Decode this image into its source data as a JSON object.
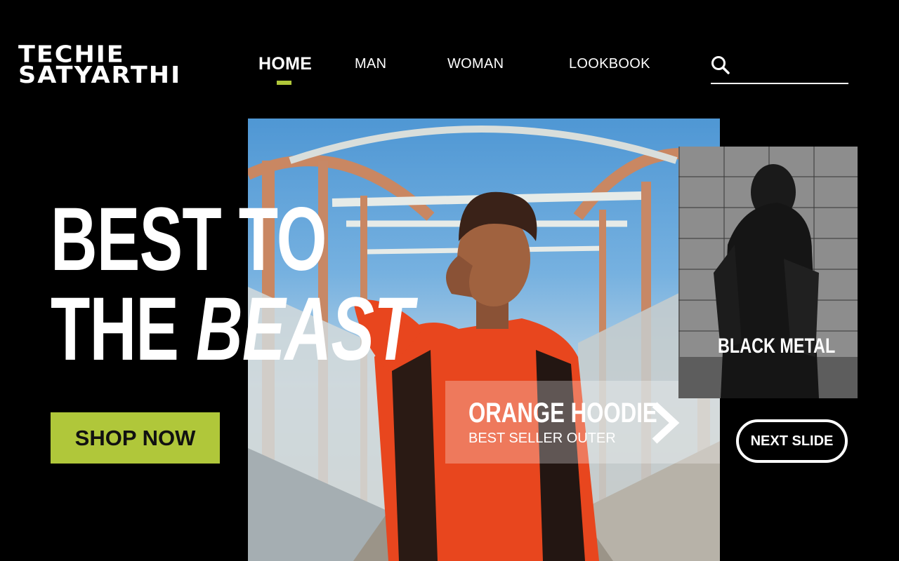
{
  "brand": {
    "line1": "TECHIE",
    "line2": "SATYARTHI",
    "accent_color": "#b0c73a"
  },
  "nav": {
    "items": [
      {
        "label": "HOME",
        "active": true
      },
      {
        "label": "MAN",
        "active": false
      },
      {
        "label": "WOMAN",
        "active": false
      },
      {
        "label": "LOOKBOOK",
        "active": false
      }
    ]
  },
  "search": {
    "icon": "search-icon",
    "value": "",
    "placeholder": ""
  },
  "hero": {
    "headline_line1": "BEST TO",
    "headline_line2_regular": "THE",
    "headline_line2_italic": "BEAST",
    "cta_label": "SHOP NOW"
  },
  "featured": {
    "title": "ORANGE HOODIE",
    "subtitle": "BEST SELLER OUTER",
    "arrow_icon": "chevron-right-icon"
  },
  "side_card": {
    "label": "BLACK METAL"
  },
  "next_slide": {
    "label": "NEXT SLIDE"
  }
}
